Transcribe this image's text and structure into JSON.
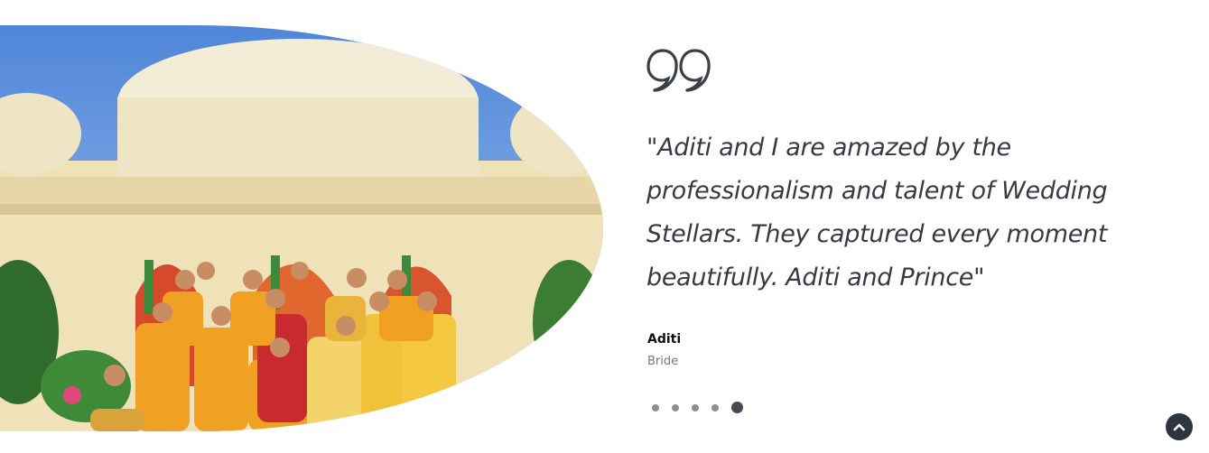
{
  "testimonial": {
    "quote": "\"Aditi and I are amazed by the professionalism and talent of Wedding Stellars. They captured every moment beautifully. Aditi and Prince\"",
    "author_name": "Aditi",
    "author_role": "Bride"
  },
  "carousel": {
    "dots": [
      {
        "active": false
      },
      {
        "active": false
      },
      {
        "active": false
      },
      {
        "active": false
      },
      {
        "active": true
      }
    ]
  },
  "icons": {
    "quote": "quote-icon",
    "scroll_top": "chevron-up-icon"
  },
  "colors": {
    "text": "#353a45",
    "accent": "#2f3540"
  }
}
